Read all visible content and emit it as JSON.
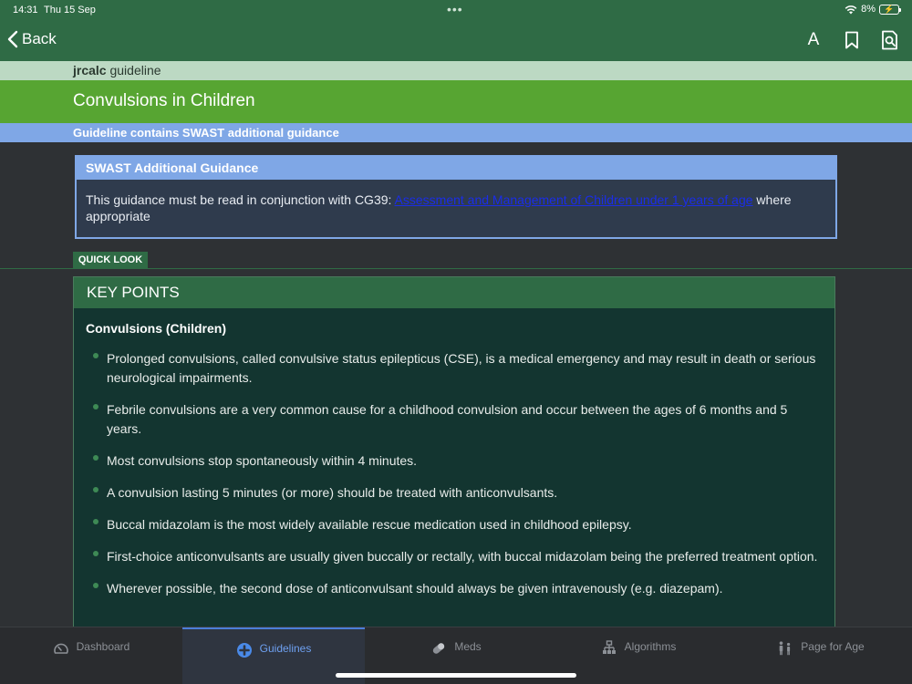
{
  "status_bar": {
    "time": "14:31",
    "date": "Thu 15 Sep",
    "battery_percent": "8%"
  },
  "nav": {
    "back_label": "Back",
    "font_size_label": "A"
  },
  "source": {
    "brand": "jrcalc",
    "suffix": " guideline"
  },
  "page_title": "Convulsions in Children",
  "notice": "Guideline contains SWAST additional guidance",
  "swast": {
    "heading": "SWAST Additional Guidance",
    "text_before": "This guidance must be read in conjunction with CG39: ",
    "link_text": "Assessment and Management of Children under 1 years of age",
    "text_after": " where appropriate"
  },
  "quick_look_label": "QUICK LOOK",
  "key_points": {
    "heading": "KEY POINTS",
    "subheading": "Convulsions (Children)",
    "items": [
      "Prolonged convulsions, called convulsive status epilepticus (CSE), is a medical emergency and may result in death or serious neurological impairments.",
      "Febrile convulsions are a very common cause for a childhood convulsion and occur between the ages of 6 months and 5 years.",
      "Most convulsions stop spontaneously within 4 minutes.",
      "A convulsion lasting 5 minutes (or more) should be treated with anticonvulsants.",
      "Buccal midazolam is the most widely available rescue medication used in childhood epilepsy.",
      "First-choice anticonvulsants are usually given buccally or rectally, with buccal midazolam being the preferred treatment option.",
      "Wherever possible, the second dose of anticonvulsant should always be given intravenously (e.g. diazepam)."
    ]
  },
  "tabs": [
    {
      "label": "Dashboard",
      "icon": "gauge-icon",
      "active": false
    },
    {
      "label": "Guidelines",
      "icon": "plus-circle-icon",
      "active": true
    },
    {
      "label": "Meds",
      "icon": "pill-icon",
      "active": false
    },
    {
      "label": "Algorithms",
      "icon": "flowchart-icon",
      "active": false
    },
    {
      "label": "Page for Age",
      "icon": "people-icon",
      "active": false
    }
  ],
  "colors": {
    "header_green": "#2f6b45",
    "title_green": "#57a532",
    "notice_blue": "#7fa7e6",
    "active_tab_blue": "#6ea0f0"
  }
}
